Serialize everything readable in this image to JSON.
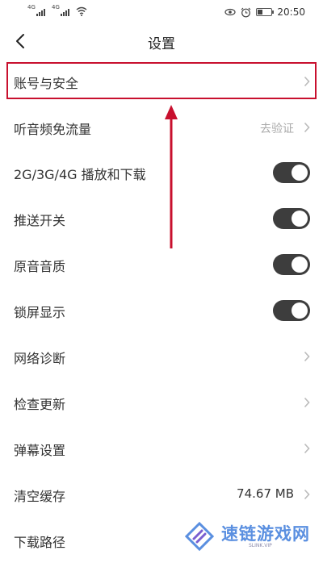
{
  "status_bar": {
    "signal_label": "4G",
    "time": "20:50",
    "icons": [
      "signal-icon",
      "signal-icon",
      "wifi-icon",
      "eye-icon",
      "alarm-icon",
      "battery-icon"
    ]
  },
  "header": {
    "title": "设置",
    "back_icon": "chevron-left-icon"
  },
  "groups": [
    {
      "items": [
        {
          "label": "账号与安全",
          "value": "",
          "control": "chevron"
        },
        {
          "label": "听音频免流量",
          "value": "去验证",
          "control": "chevron"
        }
      ]
    },
    {
      "items": [
        {
          "label": "2G/3G/4G 播放和下载",
          "control": "toggle",
          "state": "on"
        },
        {
          "label": "推送开关",
          "control": "toggle",
          "state": "on"
        },
        {
          "label": "原音音质",
          "control": "toggle",
          "state": "on"
        },
        {
          "label": "锁屏显示",
          "control": "toggle",
          "state": "on"
        }
      ]
    },
    {
      "items": [
        {
          "label": "网络诊断",
          "control": "chevron"
        },
        {
          "label": "检查更新",
          "control": "chevron"
        },
        {
          "label": "弹幕设置",
          "control": "chevron"
        },
        {
          "label": "清空缓存",
          "value": "74.67 MB",
          "control": "chevron"
        },
        {
          "label": "下载路径",
          "control": "chevron"
        }
      ]
    }
  ],
  "annotation": {
    "color": "#c8102e",
    "target": "账号与安全"
  },
  "watermark": {
    "text": "速链游戏网",
    "sub": "SLINK.VIP"
  },
  "colors": {
    "toggle_on": "#3d3d3d",
    "background": "#f2f2f2",
    "watermark": "#5a8fe0"
  }
}
